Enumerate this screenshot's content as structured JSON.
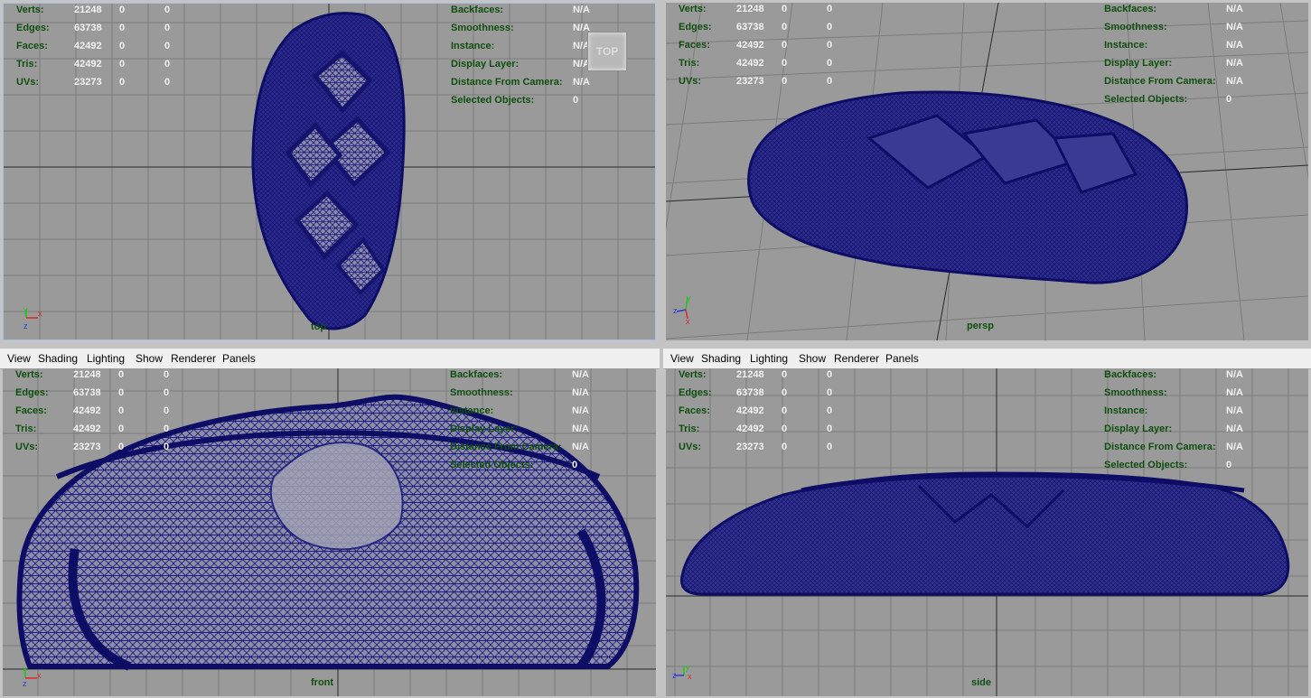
{
  "menus": [
    "View",
    "Shading",
    "Lighting",
    "Show",
    "Renderer",
    "Panels"
  ],
  "hud_left": [
    {
      "label": "Verts:",
      "values": [
        "21248",
        "0",
        "0"
      ]
    },
    {
      "label": "Edges:",
      "values": [
        "63738",
        "0",
        "0"
      ]
    },
    {
      "label": "Faces:",
      "values": [
        "42492",
        "0",
        "0"
      ]
    },
    {
      "label": "Tris:",
      "values": [
        "42492",
        "0",
        "0"
      ]
    },
    {
      "label": "UVs:",
      "values": [
        "23273",
        "0",
        "0"
      ]
    }
  ],
  "hud_right": [
    {
      "label": "Backfaces:",
      "value": "N/A"
    },
    {
      "label": "Smoothness:",
      "value": "N/A"
    },
    {
      "label": "Instance:",
      "value": "N/A"
    },
    {
      "label": "Display Layer:",
      "value": "N/A"
    },
    {
      "label": "Distance From Camera:",
      "value": "N/A"
    },
    {
      "label": "Selected Objects:",
      "value": "0"
    }
  ],
  "viewports": {
    "top": {
      "camera": "top"
    },
    "persp": {
      "camera": "persp"
    },
    "front": {
      "camera": "front"
    },
    "side": {
      "camera": "side"
    }
  },
  "viewcube": {
    "label": "TOP"
  },
  "colors": {
    "viewport_bg": "#9a9a9a",
    "grid": "#7c7c7c",
    "mesh": "#16167a",
    "hud_label": "#0e4f0e",
    "hud_value": "#f4f4f4"
  }
}
